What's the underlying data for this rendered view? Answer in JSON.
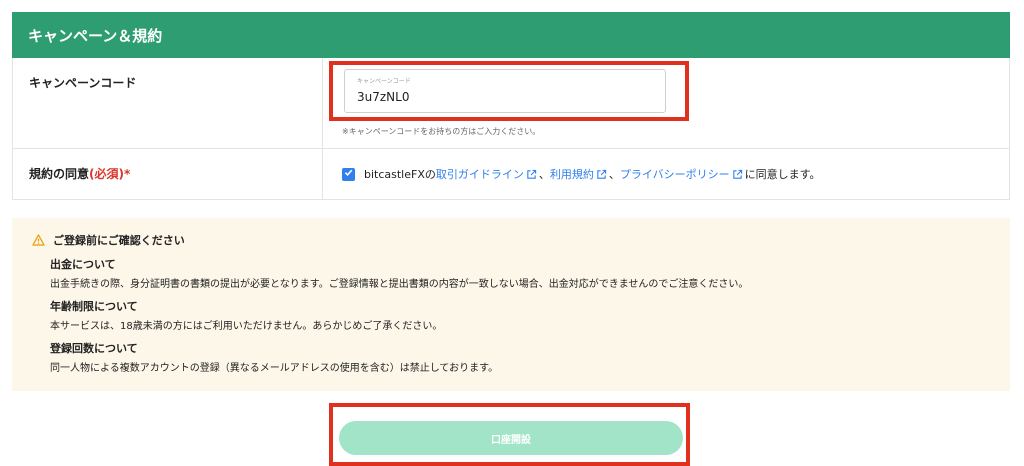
{
  "section": {
    "title": "キャンペーン＆規約"
  },
  "campaign": {
    "label": "キャンペーンコード",
    "field_label": "キャンペーンコード",
    "value": "3u7zNL0",
    "hint": "※キャンペーンコードをお持ちの方はご入力ください。"
  },
  "terms": {
    "label": "規約の同意",
    "required": "(必須)",
    "asterisk": "*",
    "prefix": "bitcastleFXの",
    "link1": "取引ガイドライン",
    "sep1": "、",
    "link2": "利用規約",
    "sep2": "、",
    "link3": "プライバシーポリシー",
    "suffix": "に同意します。",
    "checked": true
  },
  "notice": {
    "title": "ご登録前にご確認ください",
    "blocks": [
      {
        "heading": "出金について",
        "body": "出金手続きの際、身分証明書の書類の提出が必要となります。ご登録情報と提出書類の内容が一致しない場合、出金対応ができませんのでご注意ください。"
      },
      {
        "heading": "年齢制限について",
        "body": "本サービスは、18歳未満の方にはご利用いただけません。あらかじめご了承ください。"
      },
      {
        "heading": "登録回数について",
        "body": "同一人物による複数アカウントの登録（異なるメールアドレスの使用を含む）は禁止しております。"
      }
    ]
  },
  "submit": {
    "label": "口座開設"
  },
  "colors": {
    "header": "#2e9e72",
    "link": "#2f80ed",
    "highlight": "#e0301e",
    "notice_bg": "#fdf7ea",
    "button": "#a1e4c8"
  },
  "icons": {
    "check": "check-icon",
    "external": "external-link-icon",
    "warning": "warning-icon"
  }
}
